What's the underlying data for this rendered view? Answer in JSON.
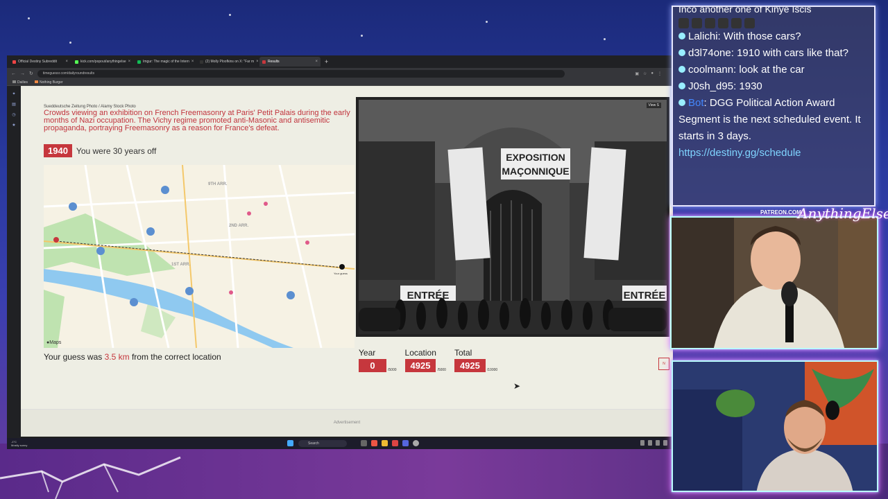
{
  "browser": {
    "tabs": [
      {
        "label": "Official Destiny Subreddit",
        "active": false
      },
      {
        "label": "kick.com/popout/anythingelse",
        "active": false
      },
      {
        "label": "Imgur: The magic of the Intern",
        "active": false
      },
      {
        "label": "(2) Molly Ploofkins on X: \"Far m",
        "active": false
      },
      {
        "label": "Results",
        "active": true
      }
    ],
    "url": "timeguessr.com/dailyroundresults",
    "bookmarks": [
      "Dailies",
      "Nothing Burger"
    ]
  },
  "result": {
    "credit": "Sueddeutsche Zeitung Photo / Alamy Stock Photo",
    "description": "Crowds viewing an exhibition on French Freemasonry at Paris' Petit Palais during the early months of Nazi occupation. The Vichy regime promoted anti-Masonic and antisemitic propaganda, portraying Freemasonry as a reason for France's defeat.",
    "year": "1940",
    "year_off_text": "You were 30 years off",
    "guess_prefix": "Your guess was ",
    "guess_distance": "3.5 km",
    "guess_suffix": " from the correct location",
    "view_source": "View S",
    "next_label": "N"
  },
  "map": {
    "labels": {
      "arr9": "9TH ARR.",
      "arr2": "2ND ARR.",
      "arr1": "1ST ARR.",
      "maps": "Maps"
    },
    "user_marker": "Your guess"
  },
  "photo": {
    "sign_main_1": "EXPOSITION",
    "sign_main_2": "MAÇONNIQUE",
    "sign_left": "EXPOSITION MAÇONNIQUE",
    "sign_right": "EXPOSITION MAÇONNIQUE",
    "banner_left": "ENTRÉE",
    "banner_right": "ENTRÉE"
  },
  "scores": [
    {
      "label": "Year",
      "value": "0",
      "max": "/5000"
    },
    {
      "label": "Location",
      "value": "4925",
      "max": "/5000"
    },
    {
      "label": "Total",
      "value": "4925",
      "max": "/10000"
    }
  ],
  "advertisement": "Advertisement",
  "taskbar": {
    "weather_temp": "-1°C",
    "weather_desc": "Mostly sunny",
    "search": "Search"
  },
  "chat": {
    "cutoff": "Inco another one of Kinye Iscis",
    "messages": [
      {
        "user": "Lalichi",
        "text": "With those cars?"
      },
      {
        "user": "d3l74one",
        "text": "1910 with cars like that?"
      },
      {
        "user": "coolmann",
        "text": "look at the car"
      },
      {
        "user": "J0sh_d95",
        "text": "1930"
      },
      {
        "user": "Bot",
        "text": "DGG Political Action Award Segment is the next scheduled event. It starts in 3 days.",
        "link": "https://destiny.gg/schedule"
      }
    ]
  },
  "overlay": {
    "patreon": "PATREON.COM/",
    "signature": "AnythingElse"
  },
  "colors": {
    "accent_red": "#c6373d",
    "page_bg": "#eeeee4",
    "chat_link": "#7fd4ff",
    "bot_name": "#4488ff"
  }
}
